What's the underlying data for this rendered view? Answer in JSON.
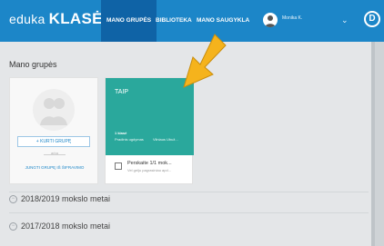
{
  "header": {
    "brand_prefix": "eduka",
    "brand_main": "KLASĖ",
    "nav": [
      "MANO GRUPĖS",
      "BIBLIOTEKA",
      "MANO SAUGYKLA"
    ],
    "user": "Monika K.",
    "chevron": "⌄",
    "logo_letter": "D"
  },
  "main": {
    "title": "Mano grupės",
    "create_card": {
      "create_button": "+ KURTI GRUPĘ",
      "or_text": "arba",
      "join_link": "JUNGTI GRUPĘ IŠ ŠIFRAVIMO"
    },
    "group_card": {
      "name": "TAIP",
      "grade": "1 klasė",
      "subject": "Pradinis ugdymas",
      "teacher": "Vilniaus Ubuž...",
      "task_title": "Perskaite 1/1 mok...",
      "task_subtitle": "Vel gelju pagrasiniau apd..."
    },
    "years": [
      "2018/2019 mokslo metai",
      "2017/2018 mokslo metai"
    ]
  },
  "colors": {
    "header": "#1c86c8",
    "active_nav": "#0f63a6",
    "group_card": "#2aa89c",
    "arrow": "#f5b31c"
  },
  "icons": [
    "avatar-icon",
    "chevron-down-icon",
    "logo-icon",
    "task-icon",
    "collapse-icon",
    "arrow-annotation-icon"
  ]
}
